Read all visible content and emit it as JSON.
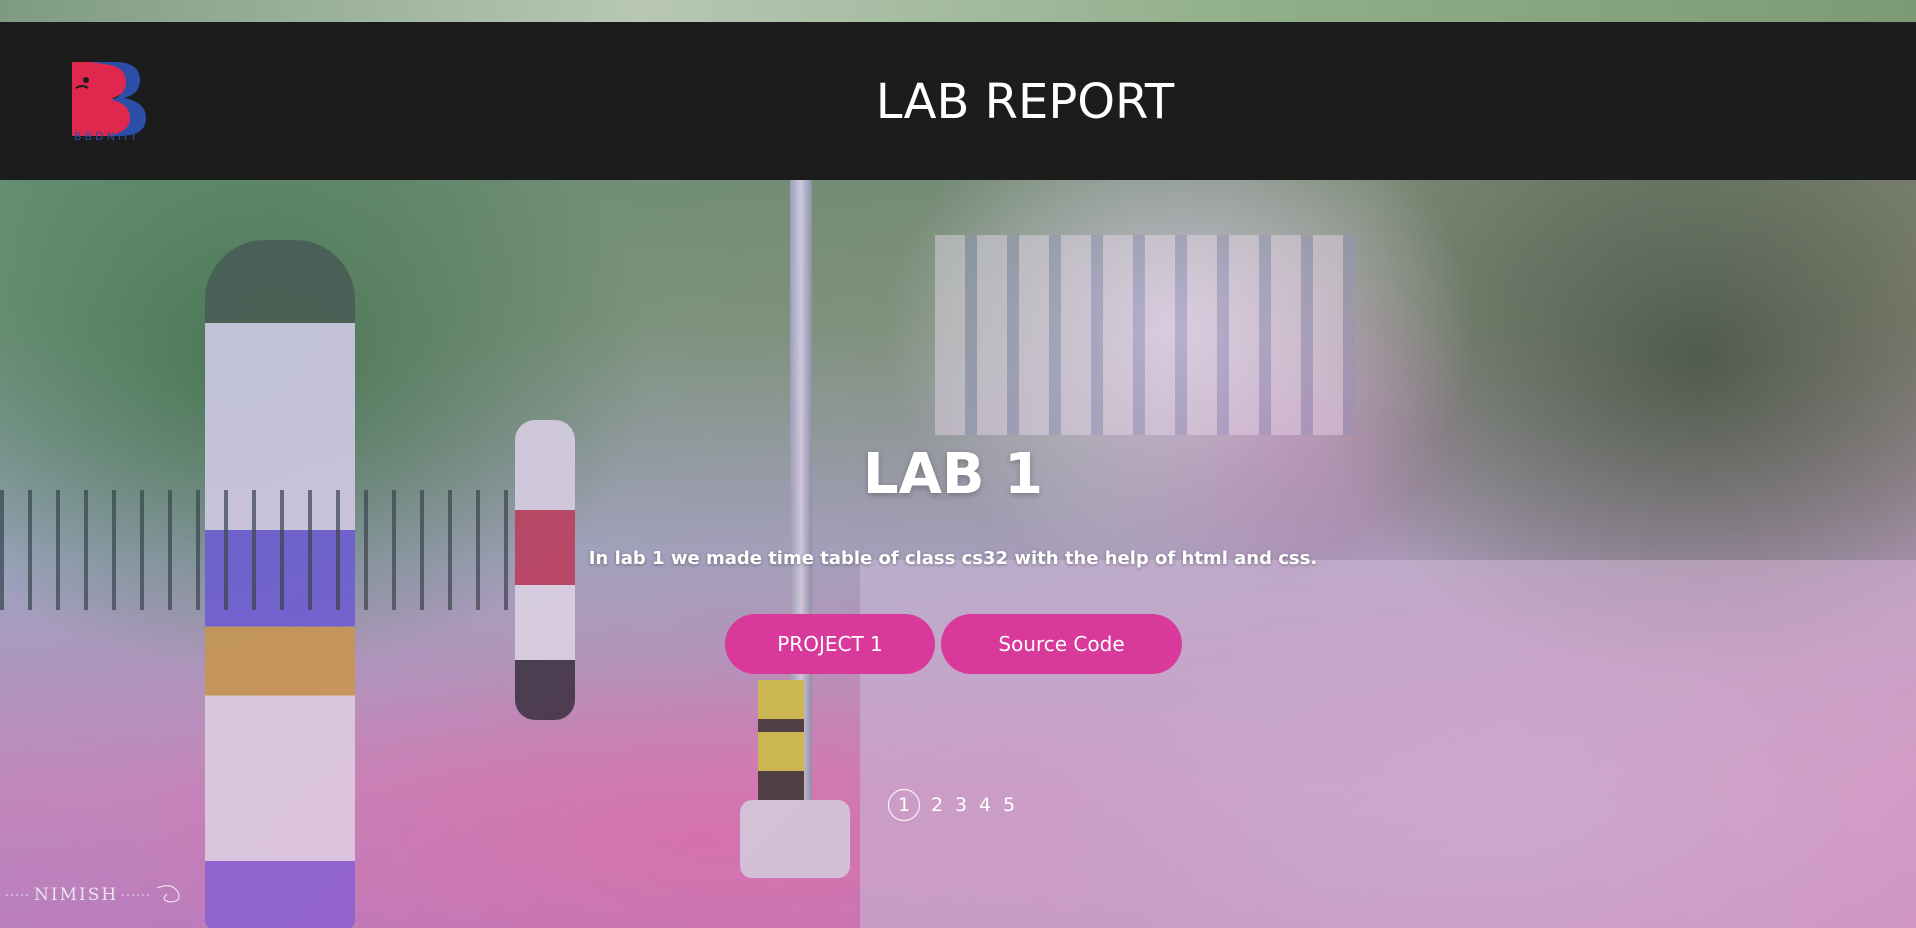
{
  "header": {
    "logo_text": "BBDNIIT",
    "title": "LAB REPORT"
  },
  "hero": {
    "heading": "LAB 1",
    "description": "In lab 1 we made time table of class cs32 with the help of html and css.",
    "buttons": {
      "project_label": "PROJECT 1",
      "source_label": "Source Code"
    }
  },
  "pagination": {
    "pages": [
      "1",
      "2",
      "3",
      "4",
      "5"
    ],
    "active_index": 0
  },
  "watermark": {
    "text": "NIMISH"
  },
  "colors": {
    "header_bg": "#1c1c1c",
    "button_bg": "#d8399a",
    "logo_red": "#e0284f",
    "logo_blue": "#2b4ea8"
  }
}
